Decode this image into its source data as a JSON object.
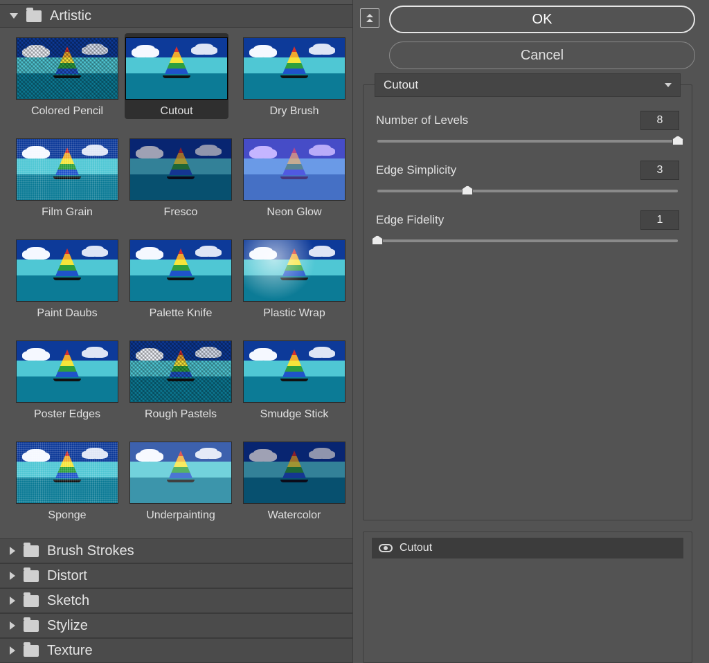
{
  "categories": {
    "expanded": {
      "name": "Artistic"
    },
    "collapsed": [
      "Brush Strokes",
      "Distort",
      "Sketch",
      "Stylize",
      "Texture"
    ]
  },
  "filters": [
    {
      "label": "Colored Pencil",
      "variant": "hatch",
      "selected": false
    },
    {
      "label": "Cutout",
      "variant": "flat",
      "selected": true
    },
    {
      "label": "Dry Brush",
      "variant": "smudge",
      "selected": false
    },
    {
      "label": "Film Grain",
      "variant": "noise",
      "selected": false
    },
    {
      "label": "Fresco",
      "variant": "dark",
      "selected": false
    },
    {
      "label": "Neon Glow",
      "variant": "purple",
      "selected": false
    },
    {
      "label": "Paint Daubs",
      "variant": "poster",
      "selected": false
    },
    {
      "label": "Palette Knife",
      "variant": "smudge",
      "selected": false
    },
    {
      "label": "Plastic Wrap",
      "variant": "plastic",
      "selected": false
    },
    {
      "label": "Poster Edges",
      "variant": "poster",
      "selected": false
    },
    {
      "label": "Rough Pastels",
      "variant": "hatch",
      "selected": false
    },
    {
      "label": "Smudge Stick",
      "variant": "smudge",
      "selected": false
    },
    {
      "label": "Sponge",
      "variant": "noise",
      "selected": false
    },
    {
      "label": "Underpainting",
      "variant": "light",
      "selected": false
    },
    {
      "label": "Watercolor",
      "variant": "dark",
      "selected": false
    }
  ],
  "buttons": {
    "ok": "OK",
    "cancel": "Cancel"
  },
  "selected_filter": "Cutout",
  "params": [
    {
      "label": "Number of Levels",
      "value": "8",
      "min": 2,
      "max": 8,
      "pos": 100
    },
    {
      "label": "Edge Simplicity",
      "value": "3",
      "min": 0,
      "max": 10,
      "pos": 30
    },
    {
      "label": "Edge Fidelity",
      "value": "1",
      "min": 1,
      "max": 3,
      "pos": 0
    }
  ],
  "applied": [
    {
      "name": "Cutout",
      "visible": true
    }
  ]
}
